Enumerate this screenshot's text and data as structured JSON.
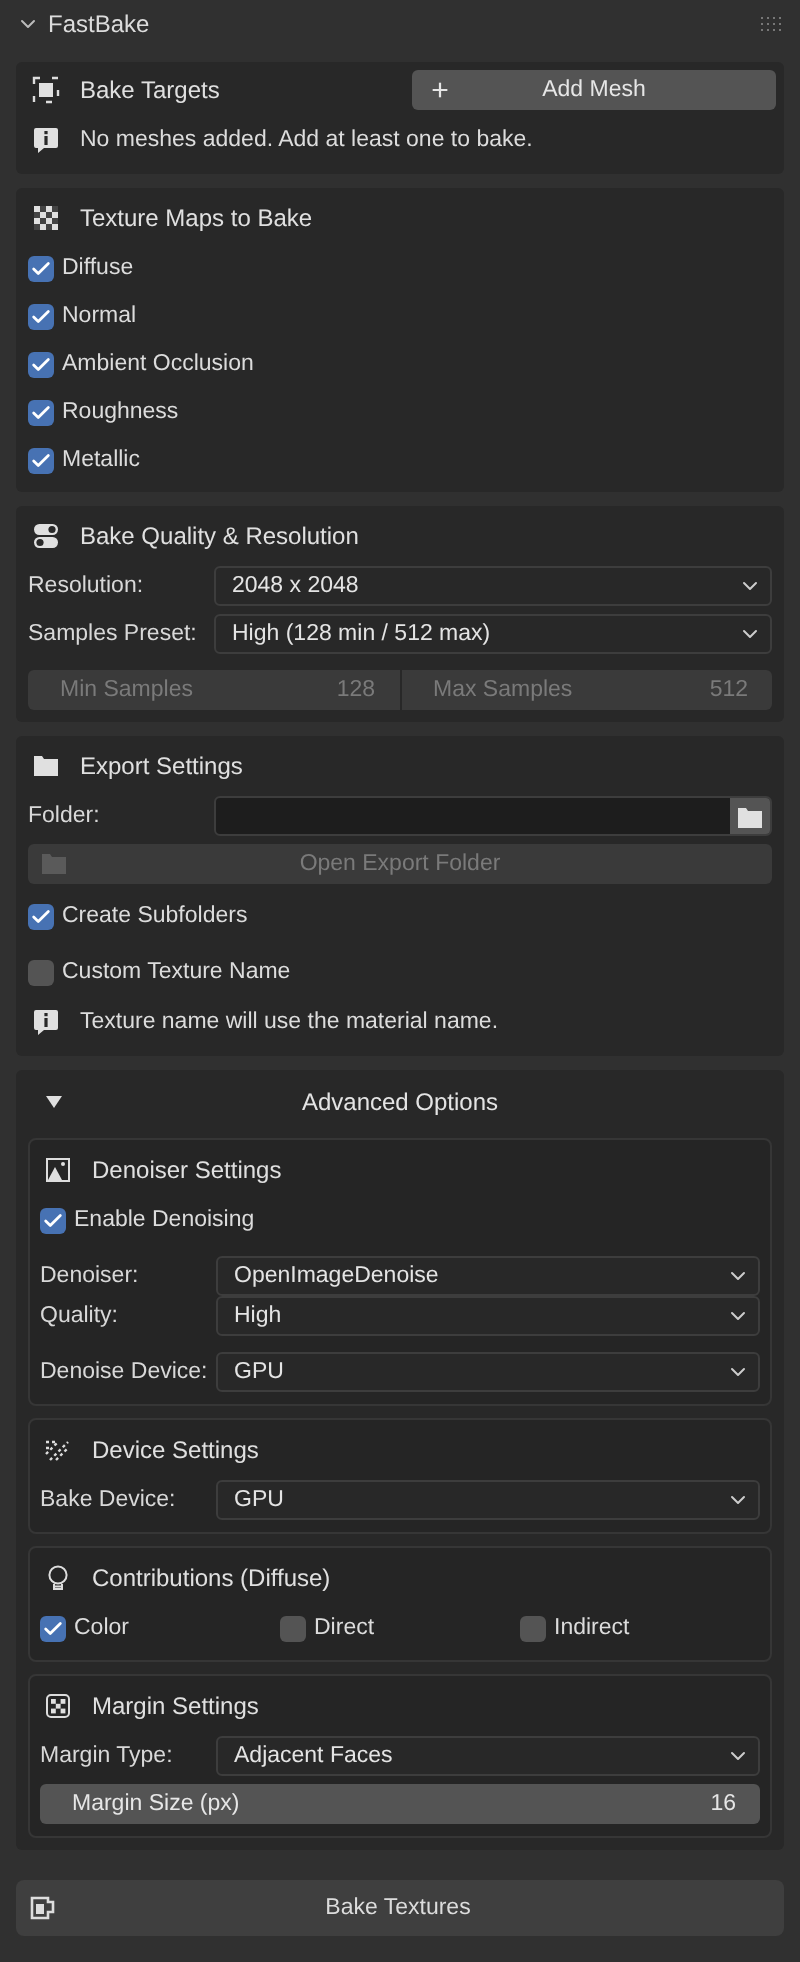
{
  "panel": {
    "title": "FastBake",
    "expanded": true
  },
  "bake_targets": {
    "title": "Bake Targets",
    "add_button": "Add Mesh",
    "add_symbol": "+",
    "info": "No meshes added. Add at least one to bake."
  },
  "texture_maps": {
    "title": "Texture Maps to Bake",
    "items": [
      {
        "label": "Diffuse",
        "checked": true
      },
      {
        "label": "Normal",
        "checked": true
      },
      {
        "label": "Ambient Occlusion",
        "checked": true
      },
      {
        "label": "Roughness",
        "checked": true
      },
      {
        "label": "Metallic",
        "checked": true
      }
    ]
  },
  "quality": {
    "title": "Bake Quality & Resolution",
    "fields": [
      {
        "label": "Resolution:",
        "value": "2048 x 2048"
      },
      {
        "label": "Samples Preset:",
        "value": "High (128 min / 512 max)"
      }
    ],
    "numbers": [
      {
        "label": "Min Samples",
        "value": "128",
        "disabled": true
      },
      {
        "label": "Max Samples",
        "value": "512",
        "disabled": true
      }
    ]
  },
  "export": {
    "title": "Export Settings",
    "folder_label": "Folder:",
    "open_button": {
      "label": "Open Export Folder",
      "disabled": true
    },
    "options": [
      {
        "label": "Create Subfolders",
        "checked": true
      },
      {
        "label": "Custom Texture Name",
        "checked": false
      }
    ],
    "info": "Texture name will use the material name."
  },
  "advanced": {
    "title": "Advanced Options",
    "expanded": true,
    "denoiser": {
      "title": "Denoiser Settings",
      "enable": {
        "label": "Enable Denoising",
        "checked": true
      },
      "fields": [
        {
          "label": "Denoiser:",
          "value": "OpenImageDenoise"
        },
        {
          "label": "Quality:",
          "value": "High"
        }
      ],
      "device": {
        "label": "Denoise Device:",
        "value": "GPU"
      }
    },
    "device": {
      "title": "Device Settings",
      "field": {
        "label": "Bake Device:",
        "value": "GPU"
      }
    },
    "contributions": {
      "title": "Contributions (Diffuse)",
      "items": [
        {
          "label": "Color",
          "checked": true
        },
        {
          "label": "Direct",
          "checked": false
        },
        {
          "label": "Indirect",
          "checked": false
        }
      ]
    },
    "margin": {
      "title": "Margin Settings",
      "field": {
        "label": "Margin Type:",
        "value": "Adjacent Faces"
      },
      "size": {
        "label": "Margin Size (px)",
        "value": "16"
      }
    }
  },
  "bake_button": "Bake Textures"
}
